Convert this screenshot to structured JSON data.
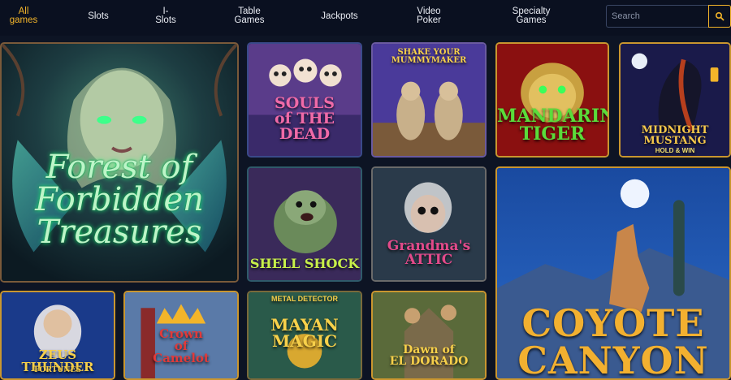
{
  "nav": {
    "items": [
      {
        "label": "All\ngames",
        "active": true
      },
      {
        "label": "Slots",
        "active": false
      },
      {
        "label": "I-\nSlots",
        "active": false
      },
      {
        "label": "Table\nGames",
        "active": false
      },
      {
        "label": "Jackpots",
        "active": false
      },
      {
        "label": "Video\nPoker",
        "active": false
      },
      {
        "label": "Specialty\nGames",
        "active": false
      }
    ],
    "search_placeholder": "Search",
    "search_icon": "search-icon"
  },
  "games": [
    {
      "id": "forest",
      "title": "Forest of\nForbidden\nTreasures"
    },
    {
      "id": "souls",
      "title": "SOULS\nof THE DEAD"
    },
    {
      "id": "shake",
      "title": "SHAKE YOUR\nMUMMYMAKER"
    },
    {
      "id": "tiger",
      "title": "MANDARIN\nTIGER"
    },
    {
      "id": "mustang",
      "title": "MIDNIGHT\nMUSTANG",
      "subtitle": "HOLD & WIN"
    },
    {
      "id": "shell",
      "title": "SHELL SHOCK"
    },
    {
      "id": "grandma",
      "title": "Grandma's\nATTIC"
    },
    {
      "id": "coyote",
      "title": "COYOTE\nCANYON"
    },
    {
      "id": "zeus",
      "title": "ZEUS THUNDER",
      "subtitle": "FORTUNES"
    },
    {
      "id": "crown",
      "title": "Crown\nof\nCamelot"
    },
    {
      "id": "mayan",
      "title": "MAYAN\nMAGIC",
      "subtitle": "METAL DETECTOR"
    },
    {
      "id": "dorado",
      "title": "Dawn of\nEL DORADO"
    }
  ],
  "colors": {
    "accent": "#f3b52a",
    "background": "#0d1424"
  }
}
